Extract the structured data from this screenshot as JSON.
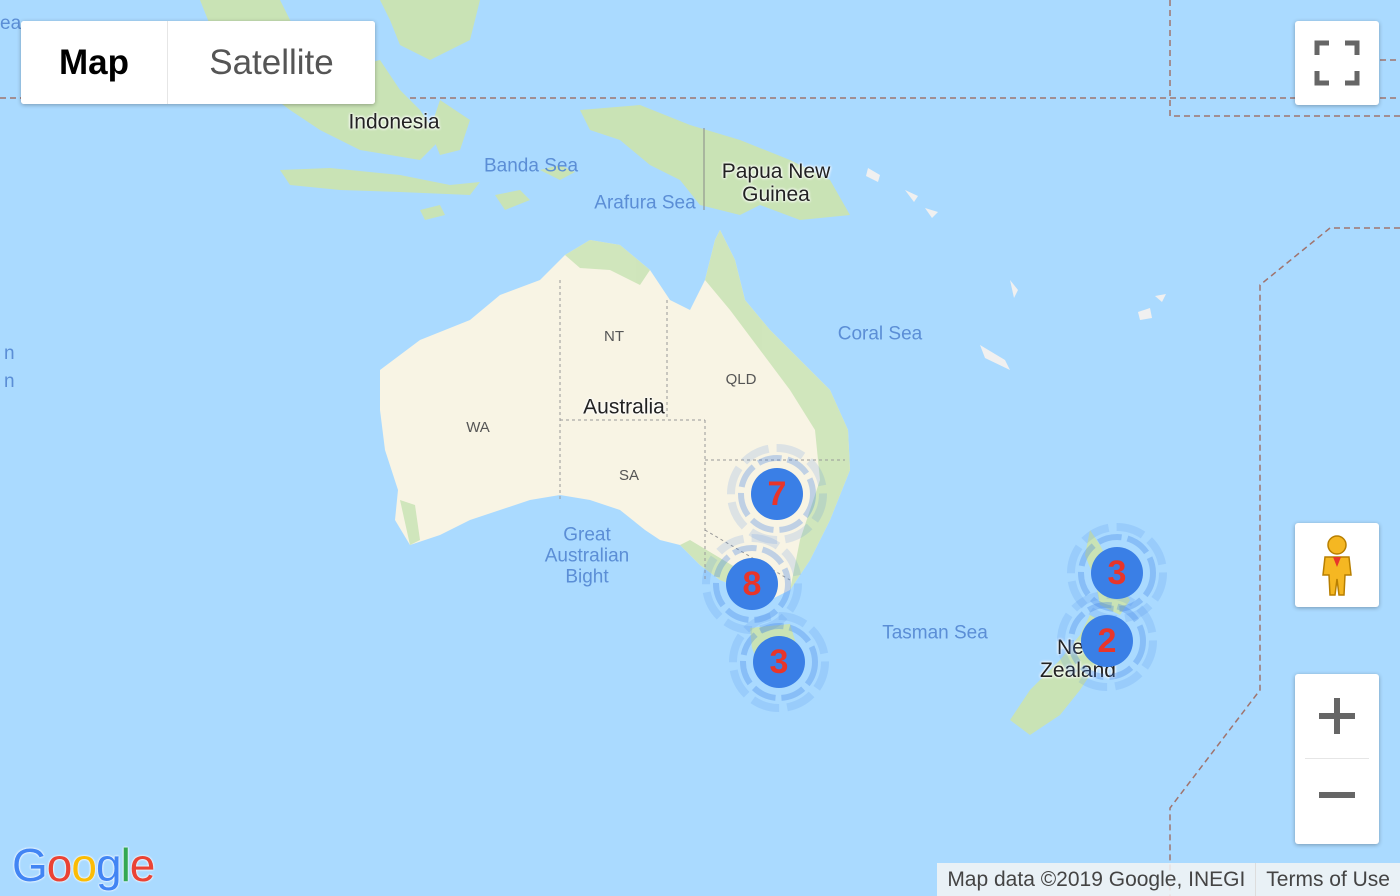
{
  "map": {
    "colors": {
      "water": "#aadaff",
      "land": "#f8f4e4",
      "vegetation": "#c9e3b5",
      "cluster": "#3a7fe6",
      "cluster_text": "#e8352a"
    },
    "labels": {
      "indonesia": "Indonesia",
      "banda_sea": "Banda Sea",
      "arafura_sea": "Arafura Sea",
      "png": "Papua New\nGuinea",
      "coral_sea": "Coral Sea",
      "australia": "Australia",
      "nt": "NT",
      "qld": "QLD",
      "wa": "WA",
      "sa": "SA",
      "great_australian_bight": "Great\nAustralian\nBight",
      "tasman_sea": "Tasman Sea",
      "new_zealand": "New\nZealand",
      "edge_top_left": "ea",
      "edge_left_1": "n",
      "edge_left_2": "n"
    },
    "clusters": [
      {
        "count": "7"
      },
      {
        "count": "8"
      },
      {
        "count": "3"
      },
      {
        "count": "3"
      },
      {
        "count": "2"
      }
    ]
  },
  "controls": {
    "map_type": {
      "map_label": "Map",
      "satellite_label": "Satellite",
      "selected": "Map"
    },
    "fullscreen": {
      "icon": "fullscreen-icon"
    },
    "pegman": {
      "icon": "pegman-icon"
    },
    "zoom": {
      "in_icon": "plus-icon",
      "out_icon": "minus-icon"
    }
  },
  "footer": {
    "logo": "Google",
    "attribution": "Map data ©2019 Google, INEGI",
    "terms": "Terms of Use"
  }
}
